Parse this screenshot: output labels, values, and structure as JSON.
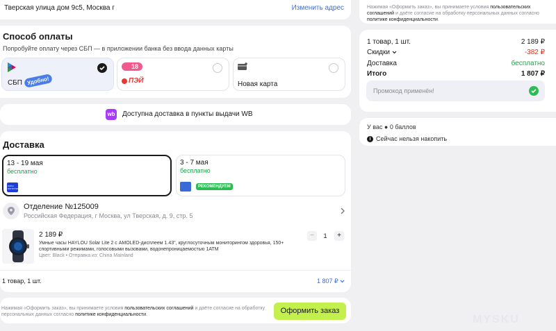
{
  "address": {
    "text": "Тверская улица дом 9с5, Москва г",
    "change": "Изменить адрес"
  },
  "payment": {
    "title": "Способ оплаты",
    "subtitle": "Попробуйте оплату через СБП — в приложении банка без ввода данных карты",
    "options": [
      {
        "label": "СБП",
        "badge": "Удобно!"
      },
      {
        "label": "",
        "badge": "18",
        "logo": "ПЭЙ"
      },
      {
        "label": "Новая карта"
      }
    ]
  },
  "wb_banner": {
    "logo": "wb",
    "text": "Доступна доставка в пункты выдачи WB"
  },
  "delivery": {
    "title": "Доставка",
    "options": [
      {
        "dates": "13 - 19 мая",
        "price": "бесплатно",
        "logo": "ОЗОН ЛОГИСТИКА"
      },
      {
        "dates": "3 - 7 мая",
        "price": "бесплатно",
        "badge": "РЕКОМЕНДУЕМ"
      }
    ],
    "pickup": {
      "name": "Отделение №125009",
      "address": "Российская Федерация, г Москва, ул Тверская, д. 9, стр. 5"
    }
  },
  "product": {
    "price": "2 189 ₽",
    "description": "Умные часы HAYLOU Solar Lite 2 с AMOLED-дисплеем 1.43\", круглосуточным мониторингом здоровья, 150+ спортивными режимами, голосовыми вызовами, водонепроницаемостью 1ATM",
    "meta": "Цвет: Black • Отправка из: China Mainland",
    "qty": "1",
    "minus": "−",
    "plus": "+"
  },
  "items_summary": {
    "count": "1 товар, 1 шт.",
    "total": "1 807 ₽"
  },
  "footer": {
    "agreement_pre": "Нажимая «Оформить заказ», вы принимаете условия ",
    "agreement_link1": "пользовательских соглашений",
    "agreement_mid": " и даёте согласие на обработку персональных данных согласно ",
    "agreement_link2": "политике конфиденциальности",
    "agreement_end": ".",
    "button": "Оформить заказ"
  },
  "sidebar": {
    "agreement_pre": "Нажимая «Оформить заказ», вы принимаете условия ",
    "agreement_link1": "пользовательских соглашений",
    "agreement_mid": " и даёте согласие на обработку персональных данных согласно ",
    "agreement_link2": "политике конфиденциальности",
    "agreement_end": ".",
    "rows": [
      {
        "label": "1 товар, 1 шт.",
        "value": "2 189 ₽"
      },
      {
        "label": "Скидки",
        "value": "-382 ₽"
      },
      {
        "label": "Доставка",
        "value": "бесплатно"
      },
      {
        "label": "Итого",
        "value": "1 807 ₽"
      }
    ],
    "promo": "Промокод применён!",
    "points": "У вас ● 0 баллов",
    "accrual": "Сейчас нельзя накопить"
  },
  "watermark": "MYSKU",
  "colors": {
    "accent_green": "#c3f04c",
    "link_blue": "#3b6fd8",
    "wb_purple": "#a73afd",
    "green_text": "#1ea34a",
    "red_text": "#e0301e"
  }
}
